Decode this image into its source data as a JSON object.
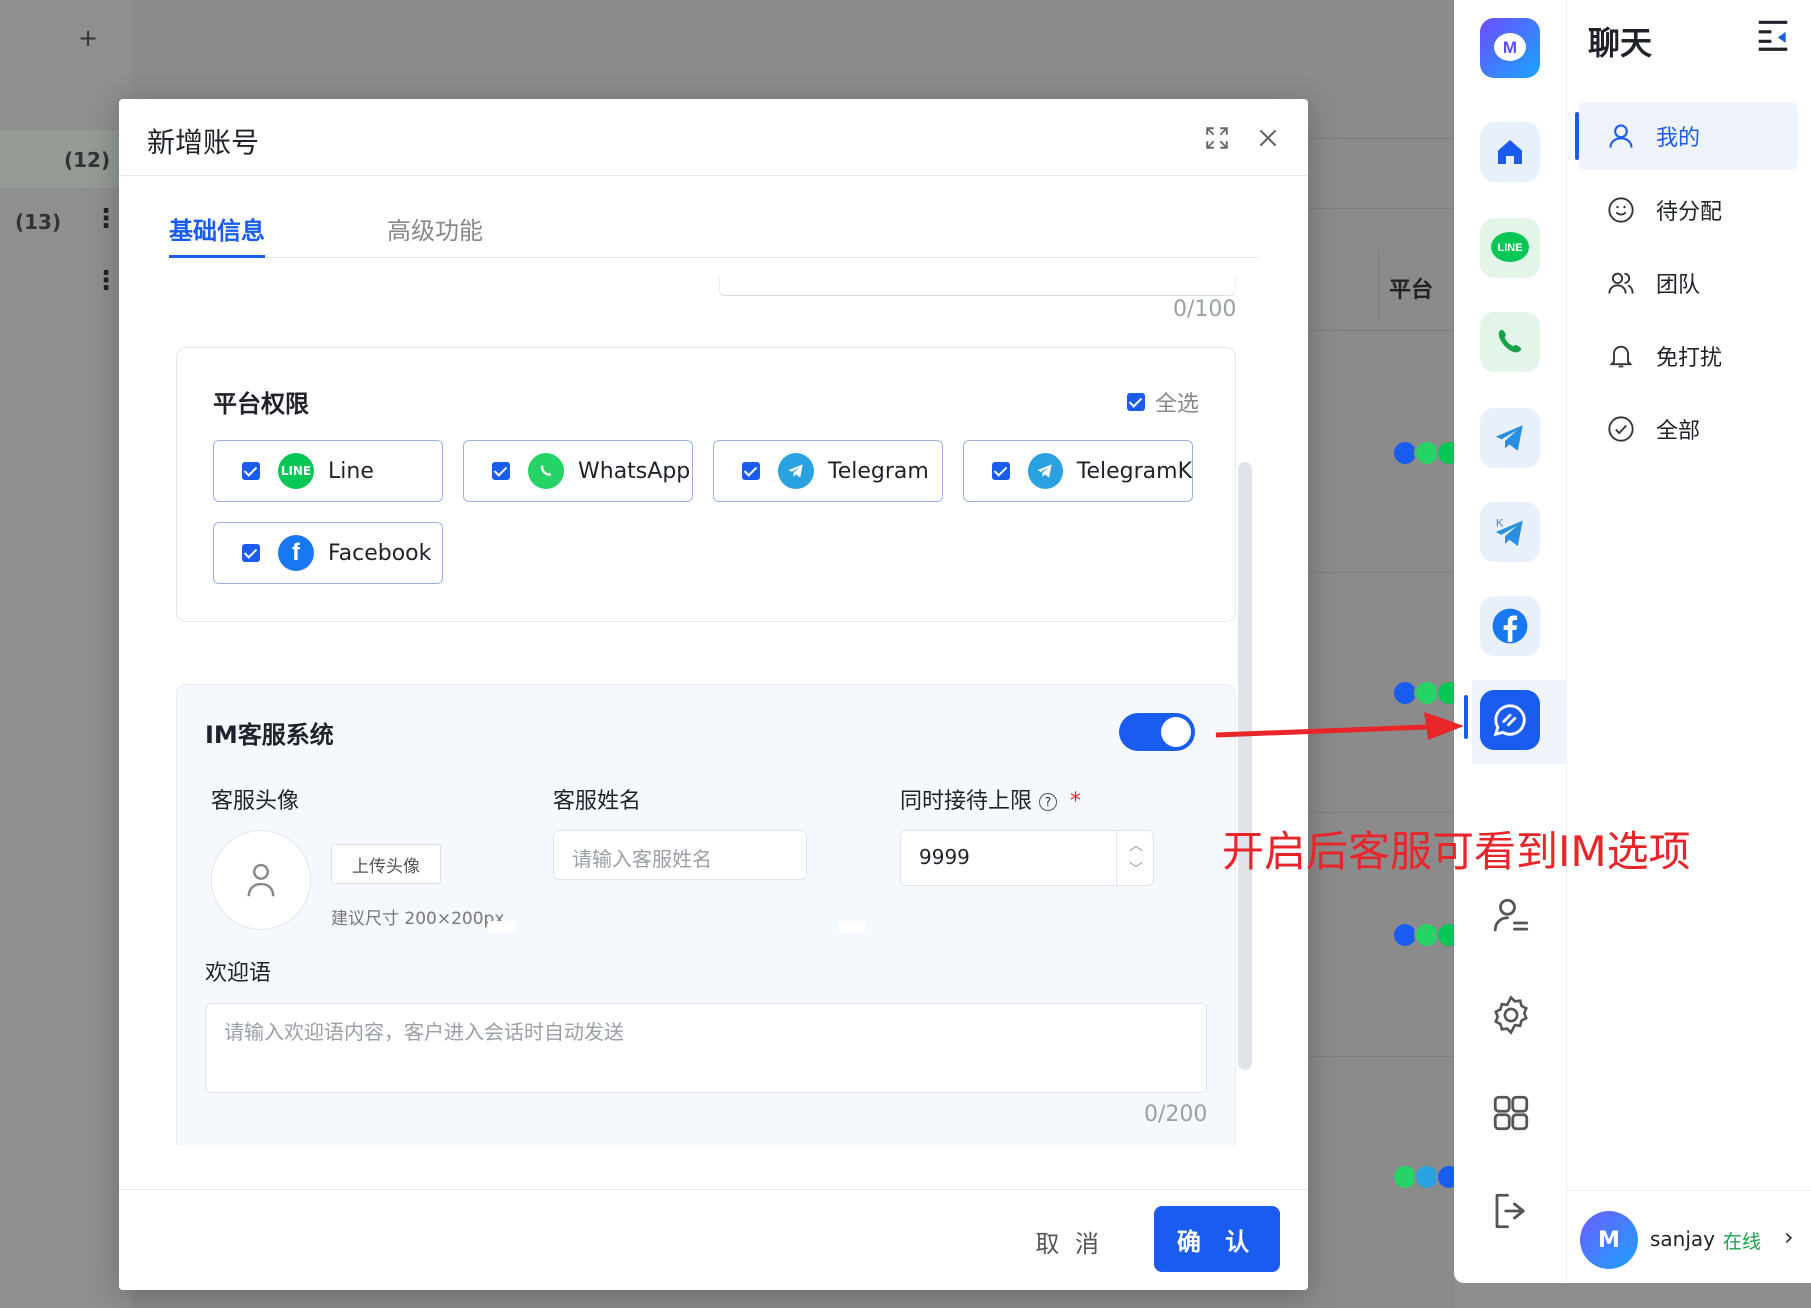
{
  "background": {
    "add_symbol": "+",
    "counts": [
      "(12)",
      "(13)"
    ],
    "column_header": "平台"
  },
  "modal": {
    "title": "新增账号",
    "tabs": [
      {
        "label": "基础信息",
        "active": true
      },
      {
        "label": "高级功能",
        "active": false
      }
    ],
    "prev_field_counter": "0/100",
    "platform_permissions": {
      "title": "平台权限",
      "select_all_label": "全选",
      "platforms": [
        {
          "name": "Line",
          "color": "#06c755",
          "checked": true
        },
        {
          "name": "WhatsApp",
          "color": "#25d366",
          "checked": true
        },
        {
          "name": "Telegram",
          "color": "#2aa1e0",
          "checked": true
        },
        {
          "name": "TelegramK",
          "color": "#2aa1e0",
          "checked": true
        },
        {
          "name": "Facebook",
          "color": "#1877f2",
          "checked": true
        }
      ]
    },
    "im_system": {
      "title": "IM客服系统",
      "enabled": true,
      "avatar_label": "客服头像",
      "upload_label": "上传头像",
      "upload_hint": "建议尺寸 200×200px",
      "name_label": "客服姓名",
      "name_placeholder": "请输入客服姓名",
      "limit_label": "同时接待上限",
      "required_mark": "*",
      "limit_value": "9999",
      "welcome_label": "欢迎语",
      "welcome_placeholder": "请输入欢迎语内容，客户进入会话时自动发送",
      "welcome_counter": "0/200"
    },
    "footer": {
      "cancel_label": "取 消",
      "confirm_label": "确 认"
    }
  },
  "sidebar": {
    "panel_title": "聊天",
    "menu": [
      {
        "label": "我的",
        "icon": "user-icon",
        "active": true
      },
      {
        "label": "待分配",
        "icon": "smile-icon",
        "active": false
      },
      {
        "label": "团队",
        "icon": "team-icon",
        "active": false
      },
      {
        "label": "免打扰",
        "icon": "bell-icon",
        "active": false
      },
      {
        "label": "全部",
        "icon": "check-circle-icon",
        "active": false
      }
    ],
    "user": {
      "name": "sanjay",
      "status": "在线",
      "avatar_letter": "M"
    }
  },
  "annotation": {
    "text": "开启后客服可看到IM选项",
    "color": "#e8262a"
  },
  "colors": {
    "primary": "#1a5cf0",
    "online": "#1aa34a"
  }
}
